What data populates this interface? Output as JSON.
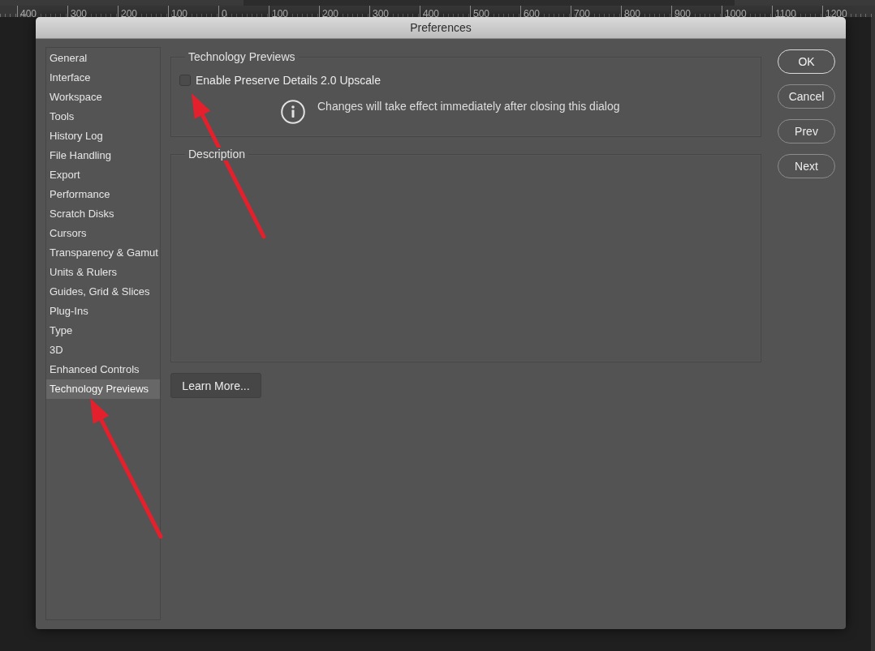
{
  "ruler": {
    "labels": [
      "400",
      "300",
      "200",
      "100",
      "0",
      "100",
      "200",
      "300",
      "400",
      "500",
      "600",
      "700",
      "800",
      "900",
      "1000",
      "1100",
      "1200"
    ]
  },
  "window": {
    "title": "Preferences"
  },
  "sidebar": {
    "items": [
      {
        "label": "General",
        "selected": false
      },
      {
        "label": "Interface",
        "selected": false
      },
      {
        "label": "Workspace",
        "selected": false
      },
      {
        "label": "Tools",
        "selected": false
      },
      {
        "label": "History Log",
        "selected": false
      },
      {
        "label": "File Handling",
        "selected": false
      },
      {
        "label": "Export",
        "selected": false
      },
      {
        "label": "Performance",
        "selected": false
      },
      {
        "label": "Scratch Disks",
        "selected": false
      },
      {
        "label": "Cursors",
        "selected": false
      },
      {
        "label": "Transparency & Gamut",
        "selected": false
      },
      {
        "label": "Units & Rulers",
        "selected": false
      },
      {
        "label": "Guides, Grid & Slices",
        "selected": false
      },
      {
        "label": "Plug-Ins",
        "selected": false
      },
      {
        "label": "Type",
        "selected": false
      },
      {
        "label": "3D",
        "selected": false
      },
      {
        "label": "Enhanced Controls",
        "selected": false
      },
      {
        "label": "Technology Previews",
        "selected": true
      }
    ]
  },
  "technology_previews": {
    "title": "Technology Previews",
    "checkbox": {
      "label": "Enable Preserve Details 2.0 Upscale",
      "checked": false
    },
    "note": "Changes will take effect immediately after closing this dialog"
  },
  "description": {
    "title": "Description"
  },
  "learn_more_button": {
    "label": "Learn More..."
  },
  "buttons": [
    {
      "label": "OK",
      "default": true
    },
    {
      "label": "Cancel",
      "default": false
    },
    {
      "label": "Prev",
      "default": false
    },
    {
      "label": "Next",
      "default": false
    }
  ],
  "annotations": [
    {
      "kind": "arrow"
    },
    {
      "kind": "arrow"
    }
  ]
}
